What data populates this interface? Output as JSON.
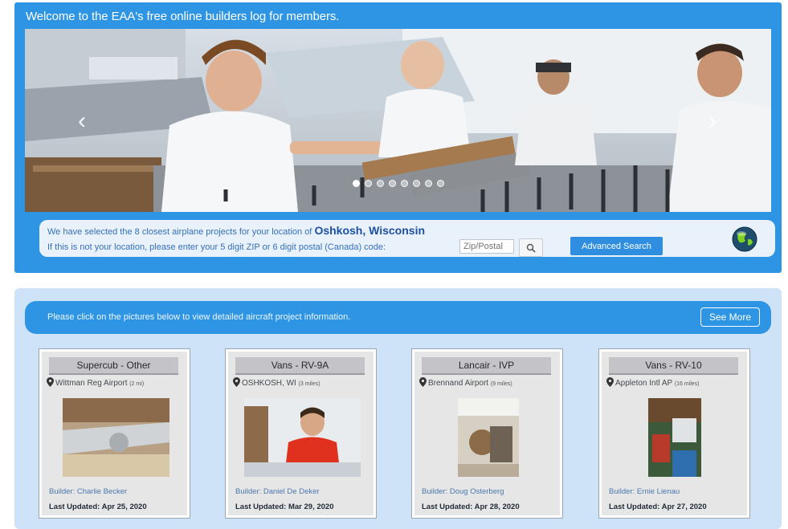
{
  "banner": {
    "welcome": "Welcome to the EAA's free online builders log for members.",
    "slide_count": 8,
    "active_slide": 1,
    "prev_glyph": "‹",
    "next_glyph": "›"
  },
  "location": {
    "line1_prefix": "We have selected the 8 closest airplane projects for your location of",
    "city": "Oshkosh, Wisconsin",
    "line2": "If this is not your location, please enter your 5 digit ZIP or 6 digit postal (Canada) code:",
    "zip_placeholder": "Zip/Postal",
    "search_icon": "magnifier-icon",
    "advanced_search": "Advanced Search",
    "globe_icon": "globe-icon"
  },
  "projects_bar": {
    "text": "Please click on the pictures below to view detailed aircraft project information.",
    "see_more": "See More"
  },
  "projects": [
    {
      "title": "Supercub - Other",
      "location": "Wittman Reg Airport",
      "distance": "(2 mi)",
      "builder": "Builder: Charlie Becker",
      "updated": "Last Updated: Apr 25, 2020"
    },
    {
      "title": "Vans - RV-9A",
      "location": "OSHKOSH, WI",
      "distance": "(3 miles)",
      "builder": "Builder: Daniel De Deker",
      "updated": "Last Updated: Mar 29, 2020"
    },
    {
      "title": "Lancair - IVP",
      "location": "Brennand Airport",
      "distance": "(9 miles)",
      "builder": "Builder: Doug Osterberg",
      "updated": "Last Updated: Apr 28, 2020"
    },
    {
      "title": "Vans - RV-10",
      "location": "Appleton Intl AP",
      "distance": "(16 miles)",
      "builder": "Builder: Ernie Lienau",
      "updated": "Last Updated: Apr 27, 2020"
    }
  ],
  "colors": {
    "brand_blue": "#2e95e4",
    "light_panel": "#cfe3f8",
    "city_text": "#1d4fa3"
  }
}
